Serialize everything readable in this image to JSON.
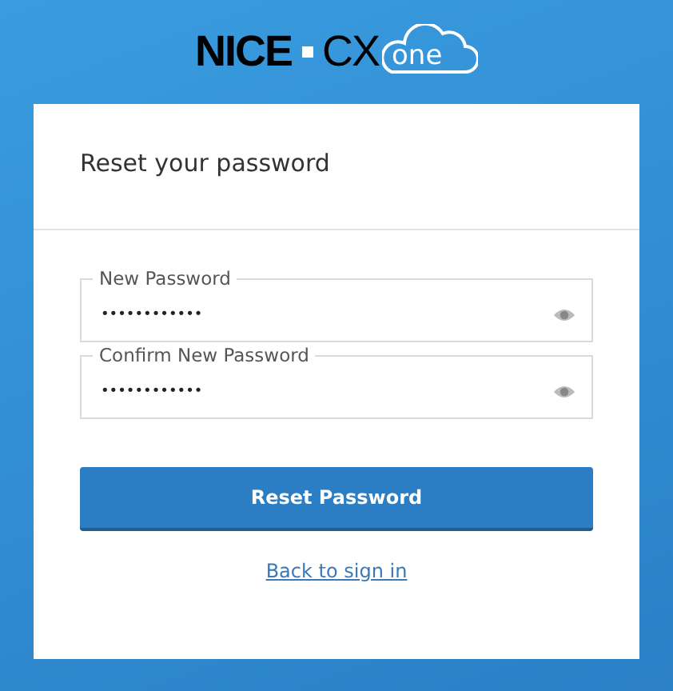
{
  "logo": {
    "brand": "NICE",
    "product": "CX",
    "cloud_text": "one"
  },
  "card": {
    "title": "Reset your password",
    "fields": [
      {
        "label": "New Password",
        "value": "••••••••••••"
      },
      {
        "label": "Confirm New Password",
        "value": "••••••••••••"
      }
    ],
    "submit_button": "Reset Password",
    "back_link": "Back to sign in"
  }
}
